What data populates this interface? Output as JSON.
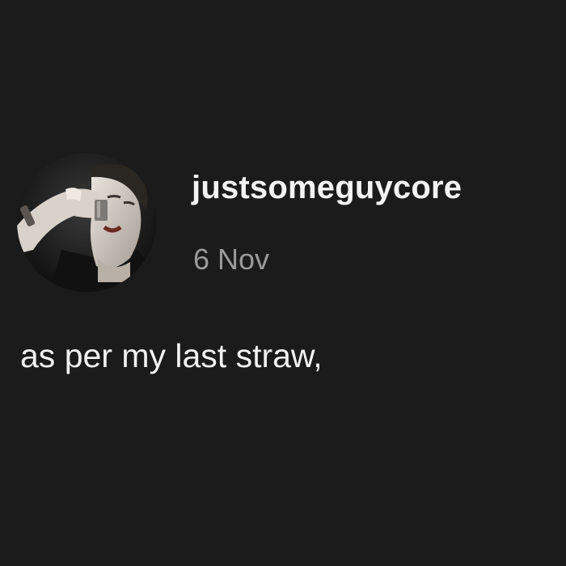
{
  "post": {
    "avatar_icon": "user-avatar-photo",
    "username": "justsomeguycore",
    "date": "6 Nov",
    "text": "as per my last straw,"
  },
  "colors": {
    "background": "#1b1b1c",
    "username": "#f3f3f3",
    "date": "#9a9a9a",
    "body_text": "#f2f2f2"
  }
}
